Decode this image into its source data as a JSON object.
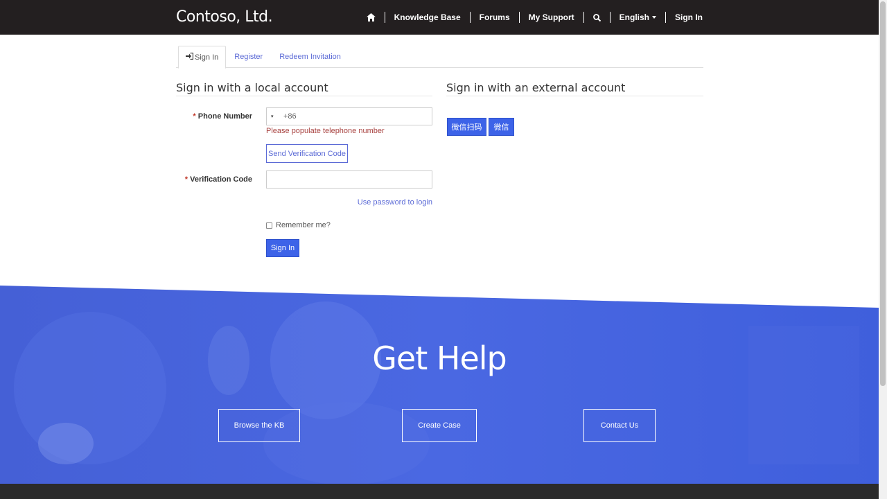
{
  "brand": "Contoso, Ltd.",
  "nav": {
    "home_icon": "home-icon",
    "knowledge_base": "Knowledge Base",
    "forums": "Forums",
    "my_support": "My Support",
    "search_icon": "search-icon",
    "language": "English",
    "sign_in": "Sign In"
  },
  "tabs": [
    {
      "label": "Sign In",
      "active": true,
      "icon": "sign-in-icon"
    },
    {
      "label": "Register",
      "active": false
    },
    {
      "label": "Redeem Invitation",
      "active": false
    }
  ],
  "local": {
    "title": "Sign in with a local account",
    "phone_label": "Phone Number",
    "phone_required_mark": "*",
    "phone_flag": "▾",
    "phone_prefix": "+86",
    "phone_error": "Please populate telephone number",
    "send_code_button": "Send Verification Code",
    "code_label": "Verification Code",
    "code_required_mark": "*",
    "code_value": "",
    "use_password_link": "Use password to login",
    "remember_label": "Remember me?",
    "remember_checked": false,
    "sign_in_button": "Sign In"
  },
  "external": {
    "title": "Sign in with an external account",
    "buttons": [
      "微信扫码",
      "微信"
    ]
  },
  "help": {
    "title": "Get Help",
    "buttons": [
      "Browse the KB",
      "Create Case",
      "Contact Us"
    ]
  },
  "colors": {
    "nav_bg": "#231f20",
    "accent": "#3d63e8",
    "link": "#5b6ad6",
    "error": "#a94442",
    "band": "#4a68e0",
    "footer": "#2b2b2b"
  }
}
